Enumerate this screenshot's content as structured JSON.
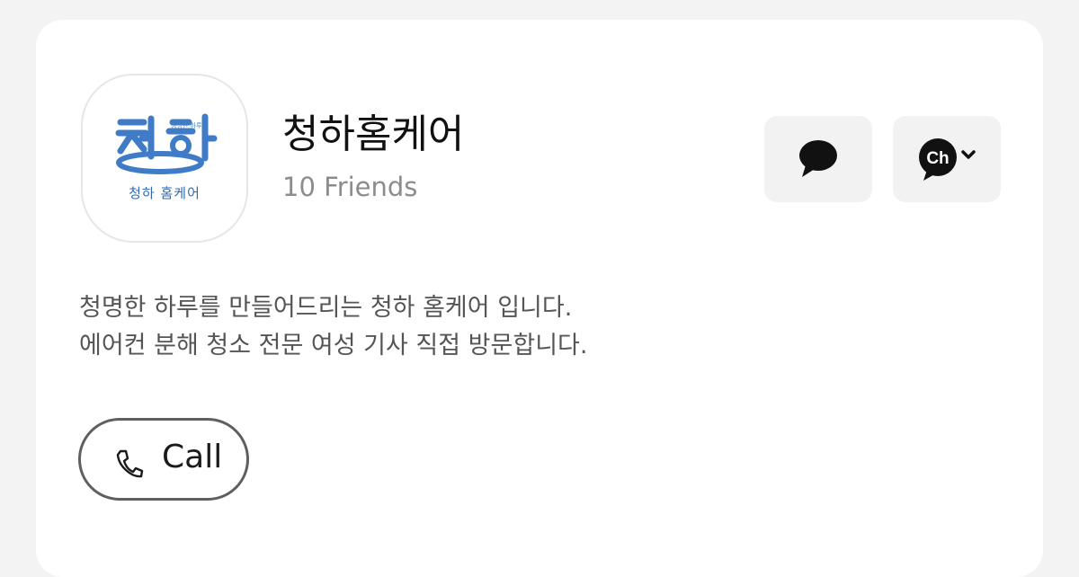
{
  "profile": {
    "logo": {
      "tagline": "청명한 하루",
      "main_text": "청하",
      "sub_text": "청하 홈케어",
      "color": "#3f7bc6"
    },
    "name": "청하홈케어",
    "friends": "10 Friends"
  },
  "actions": {
    "chat_icon": "speech-bubble-icon",
    "channel_icon": "kakao-channel-icon",
    "channel_text": "Ch"
  },
  "description": {
    "lines": [
      "청명한 하루를 만들어드리는 청하 홈케어 입니다.",
      "에어컨 분해 청소 전문 여성 기사 직접 방문합니다."
    ]
  },
  "call": {
    "label": "Call",
    "icon": "phone-icon"
  }
}
